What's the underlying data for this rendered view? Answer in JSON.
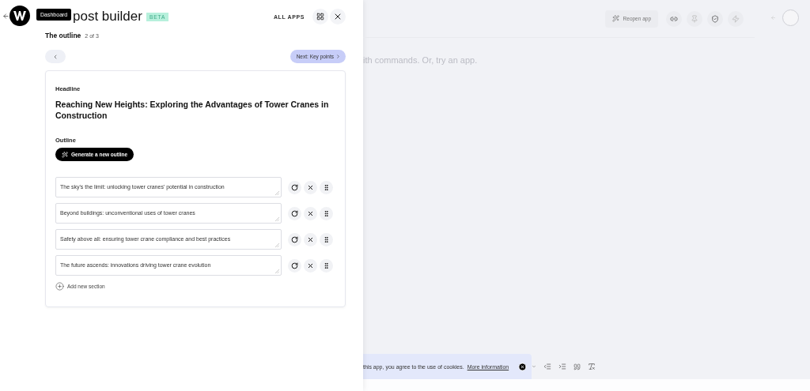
{
  "header": {
    "tooltip": "Dashboard",
    "title": "post builder",
    "badge": "BETA",
    "all_apps": "ALL APPS"
  },
  "step": {
    "title": "The outline",
    "counter": "2 of 3"
  },
  "nav": {
    "next": "Next: Key points"
  },
  "card": {
    "headline_label": "Headline",
    "headline": "Reaching New Heights: Exploring the Advantages of Tower Cranes in Construction",
    "outline_label": "Outline",
    "generate": "Generate a new outline",
    "sections": [
      "The sky's the limit: unlocking tower cranes' potential in construction",
      "Beyond buildings: unconventional uses of tower cranes",
      "Safety above all: ensuring tower crane compliance and best practices",
      "The future ascends: innovations driving tower crane evolution"
    ],
    "add": "Add new section"
  },
  "editor": {
    "reopen": "Reopen app",
    "hint": "ith commands. Or, try an app."
  },
  "cookie_banner": {
    "text": "this app, you agree to the use of cookies.",
    "link": "More information"
  }
}
